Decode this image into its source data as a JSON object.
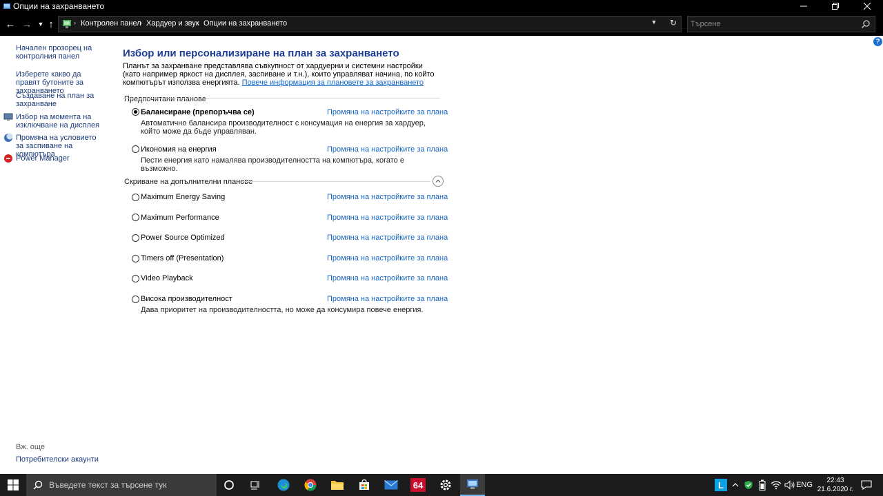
{
  "window": {
    "title": "Опции на захранването"
  },
  "nav": {
    "breadcrumb": [
      "Контролен панел",
      "Хардуер и звук",
      "Опции на захранването"
    ],
    "search_placeholder": "Търсене"
  },
  "left_panel": {
    "links": [
      "Начален прозорец на контролния панел",
      "Изберете какво да правят бутоните за захранването",
      "Създаване на план за захранване",
      "Избор на момента на изключване на дисплея",
      "Промяна на условието за заспиване на компютъра",
      "Power Manager"
    ],
    "see_also": "Вж. още",
    "user_accounts": "Потребителски акаунти"
  },
  "main": {
    "title": "Избор или персонализиране на план за захранването",
    "description": "Планът за захранване представлява съвкупност от хардуерни и системни настройки  (като например яркост на дисплея, заспиване и т.н.), които управляват начина, по който компютърът използва енергията.",
    "more_info_link": "Повече информация за плановете за захранването",
    "preferred_header": "Предпочитани планове",
    "hidden_header": "Скриване на допълнителни планове",
    "change_label": "Промяна на настройките за плана",
    "preferred_plans": [
      {
        "name": "Балансиране (препоръчва се)",
        "selected": true,
        "description": "Автоматично балансира производителност с консумация на енергия за хардуер, който може да бъде управляван."
      },
      {
        "name": "Икономия на енергия",
        "selected": false,
        "description": "Пести енергия като намалява производителността на компютъра, когато е възможно."
      }
    ],
    "additional_plans": [
      {
        "name": "Maximum Energy Saving",
        "selected": false,
        "description": ""
      },
      {
        "name": "Maximum Performance",
        "selected": false,
        "description": ""
      },
      {
        "name": "Power Source Optimized",
        "selected": false,
        "description": ""
      },
      {
        "name": "Timers off (Presentation)",
        "selected": false,
        "description": ""
      },
      {
        "name": "Video Playback",
        "selected": false,
        "description": ""
      },
      {
        "name": "Висока производителност",
        "selected": false,
        "description": "Дава приоритет на производителността, но може да консумира повече енергия."
      }
    ]
  },
  "taskbar": {
    "search_placeholder": "Въведете текст за търсене тук",
    "badge_64": "64",
    "language": "ENG",
    "time": "22:43",
    "date": "21.6.2020 г.",
    "apps": [
      "cortana-icon",
      "task-view-icon",
      "edge-icon",
      "chrome-icon",
      "file-explorer-icon",
      "store-icon",
      "mail-icon",
      "aida64-icon",
      "settings-icon",
      "control-panel-icon"
    ]
  }
}
